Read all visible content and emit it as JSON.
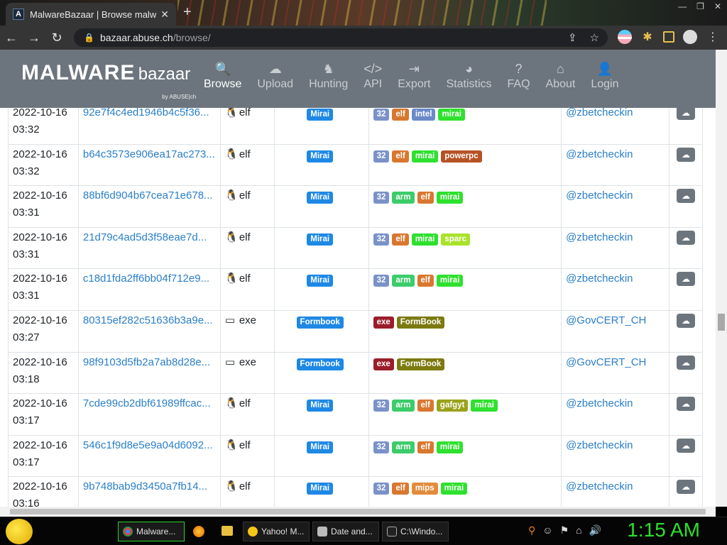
{
  "browser": {
    "tab_title": "MalwareBazaar | Browse malware",
    "favicon_letter": "A",
    "url_host": "bazaar.abuse.ch",
    "url_path": "/browse/"
  },
  "site": {
    "logo_main": "MALWARE",
    "logo_sub": "bazaar",
    "logo_by": "by ABUSE|ch",
    "nav": [
      {
        "label": "Browse",
        "icon": "search-icon"
      },
      {
        "label": "Upload",
        "icon": "upload-icon"
      },
      {
        "label": "Hunting",
        "icon": "hunting-icon"
      },
      {
        "label": "API",
        "icon": "code-icon"
      },
      {
        "label": "Export",
        "icon": "export-icon"
      },
      {
        "label": "Statistics",
        "icon": "pie-chart-icon"
      },
      {
        "label": "FAQ",
        "icon": "question-icon"
      },
      {
        "label": "About",
        "icon": "building-icon"
      },
      {
        "label": "Login",
        "icon": "user-icon"
      }
    ],
    "active_nav": "Browse"
  },
  "rows": [
    {
      "date": "2022-10-16",
      "time": "03:32",
      "hash": "92e7f4c4ed1946b4c5f36...",
      "type": "elf",
      "signature": "Mirai",
      "tags": [
        "32",
        "elf",
        "intel",
        "mirai"
      ],
      "reporter": "@zbetcheckin"
    },
    {
      "date": "2022-10-16",
      "time": "03:32",
      "hash": "b64c3573e906ea17ac273...",
      "type": "elf",
      "signature": "Mirai",
      "tags": [
        "32",
        "elf",
        "mirai",
        "powerpc"
      ],
      "reporter": "@zbetcheckin"
    },
    {
      "date": "2022-10-16",
      "time": "03:31",
      "hash": "88bf6d904b67cea71e678...",
      "type": "elf",
      "signature": "Mirai",
      "tags": [
        "32",
        "arm",
        "elf",
        "mirai"
      ],
      "reporter": "@zbetcheckin"
    },
    {
      "date": "2022-10-16",
      "time": "03:31",
      "hash": "21d79c4ad5d3f58eae7d...",
      "type": "elf",
      "signature": "Mirai",
      "tags": [
        "32",
        "elf",
        "mirai",
        "sparc"
      ],
      "reporter": "@zbetcheckin"
    },
    {
      "date": "2022-10-16",
      "time": "03:31",
      "hash": "c18d1fda2ff6bb04f712e9...",
      "type": "elf",
      "signature": "Mirai",
      "tags": [
        "32",
        "arm",
        "elf",
        "mirai"
      ],
      "reporter": "@zbetcheckin"
    },
    {
      "date": "2022-10-16",
      "time": "03:27",
      "hash": "80315ef282c51636b3a9e...",
      "type": "exe",
      "signature": "Formbook",
      "tags": [
        "exe",
        "FormBook"
      ],
      "reporter": "@GovCERT_CH"
    },
    {
      "date": "2022-10-16",
      "time": "03:18",
      "hash": "98f9103d5fb2a7ab8d28e...",
      "type": "exe",
      "signature": "Formbook",
      "tags": [
        "exe",
        "FormBook"
      ],
      "reporter": "@GovCERT_CH"
    },
    {
      "date": "2022-10-16",
      "time": "03:17",
      "hash": "7cde99cb2dbf61989ffcac...",
      "type": "elf",
      "signature": "Mirai",
      "tags": [
        "32",
        "arm",
        "elf",
        "gafgyt",
        "mirai"
      ],
      "reporter": "@zbetcheckin"
    },
    {
      "date": "2022-10-16",
      "time": "03:17",
      "hash": "546c1f9d8e5e9a04d6092...",
      "type": "elf",
      "signature": "Mirai",
      "tags": [
        "32",
        "arm",
        "elf",
        "mirai"
      ],
      "reporter": "@zbetcheckin"
    },
    {
      "date": "2022-10-16",
      "time": "03:16",
      "hash": "9b748bab9d3450a7fb14...",
      "type": "elf",
      "signature": "Mirai",
      "tags": [
        "32",
        "elf",
        "mips",
        "mirai"
      ],
      "reporter": "@zbetcheckin"
    }
  ],
  "tag_colors": {
    "32": "#7a92c8",
    "elf": "#d9772f",
    "intel": "#6a8ac8",
    "mirai": "#2ee12e",
    "powerpc": "#b55225",
    "arm": "#3ccc6a",
    "sparc": "#a8e22a",
    "exe": "#9b1c2a",
    "FormBook": "#7c7a10",
    "gafgyt": "#9aa21a",
    "mips": "#e28b3a"
  },
  "taskbar": {
    "items": [
      {
        "label": "Malware...",
        "icon": "chrome-icon",
        "active": true
      },
      {
        "label": "Yahoo! M...",
        "icon": "yahoo-messenger-icon",
        "active": false
      },
      {
        "label": "Date and...",
        "icon": "clock-settings-icon",
        "active": false
      },
      {
        "label": "C:\\Windo...",
        "icon": "cmd-icon",
        "active": false
      }
    ],
    "clock": "1:15 AM"
  }
}
